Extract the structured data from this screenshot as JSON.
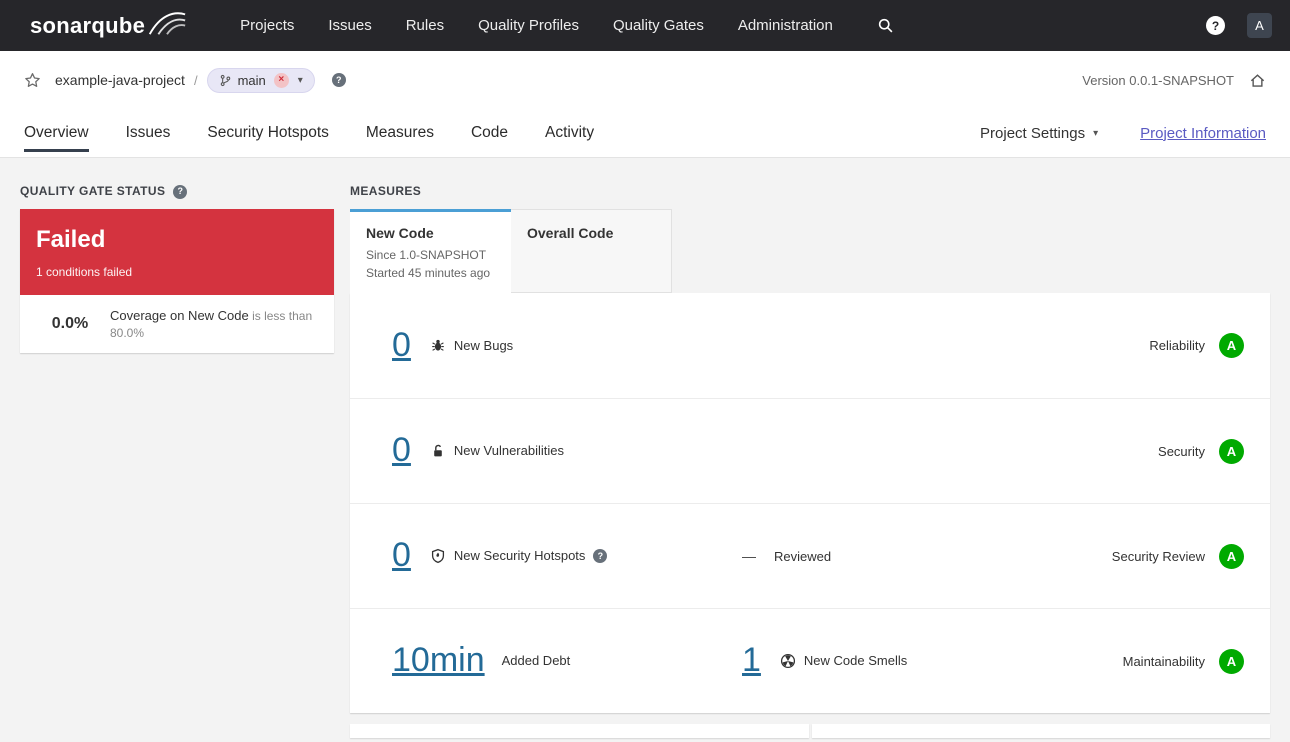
{
  "colors": {
    "topnav_bg": "#26262a",
    "failed_red": "#d4333f",
    "rating_a_green": "#00aa00",
    "link_blue": "#236a97",
    "new_code_tab_accent": "#4b9fd5",
    "project_information_link": "#5a5ac2"
  },
  "icons": {
    "chevron_down": "▾",
    "close": "×",
    "help": "?",
    "dash": "—"
  },
  "topnav": {
    "brand": "sonarqube",
    "items": [
      "Projects",
      "Issues",
      "Rules",
      "Quality Profiles",
      "Quality Gates",
      "Administration"
    ],
    "avatar_initial": "A"
  },
  "breadcrumb": {
    "project": "example-java-project",
    "separator": "/",
    "branch": "main",
    "version": "Version 0.0.1-SNAPSHOT"
  },
  "project_tabs": {
    "items": [
      "Overview",
      "Issues",
      "Security Hotspots",
      "Measures",
      "Code",
      "Activity"
    ],
    "active": "Overview",
    "settings_label": "Project Settings",
    "information_label": "Project Information"
  },
  "quality_gate": {
    "heading": "QUALITY GATE STATUS",
    "status": "Failed",
    "conditions_summary": "1 conditions failed",
    "condition": {
      "value": "0.0%",
      "metric": "Coverage on New Code",
      "detail": "is less than 80.0%"
    }
  },
  "measures": {
    "heading": "MEASURES",
    "new_code_tab": {
      "label": "New Code",
      "since": "Since 1.0-SNAPSHOT",
      "started": "Started 45 minutes ago"
    },
    "overall_tab": {
      "label": "Overall Code"
    },
    "reliability": {
      "value": "0",
      "label": "New Bugs",
      "category": "Reliability",
      "rating": "A"
    },
    "security": {
      "value": "0",
      "label": "New Vulnerabilities",
      "category": "Security",
      "rating": "A"
    },
    "security_review": {
      "value": "0",
      "label": "New Security Hotspots",
      "reviewed_value": "—",
      "reviewed_label": "Reviewed",
      "category": "Security Review",
      "rating": "A"
    },
    "maintainability": {
      "debt_value": "10min",
      "debt_label": "Added Debt",
      "smells_value": "1",
      "smells_label": "New Code Smells",
      "category": "Maintainability",
      "rating": "A"
    }
  }
}
